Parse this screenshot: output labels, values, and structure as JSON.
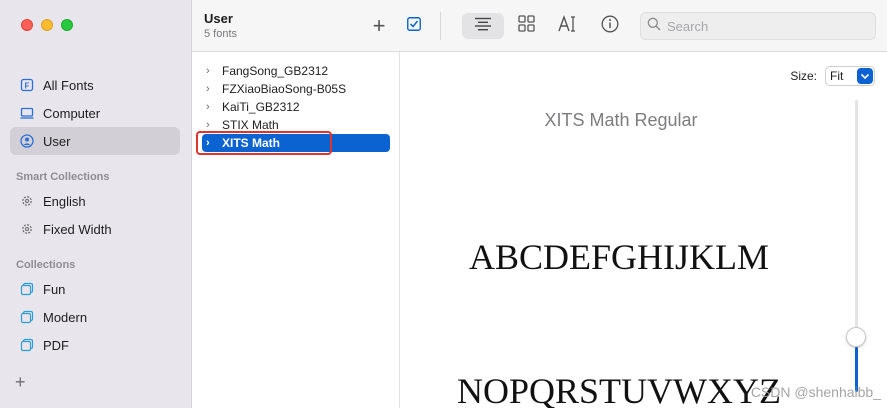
{
  "sidebar": {
    "items_top": [
      {
        "label": "All Fonts",
        "icon": "font-book-icon"
      },
      {
        "label": "Computer",
        "icon": "computer-icon"
      },
      {
        "label": "User",
        "icon": "user-icon",
        "selected": true
      }
    ],
    "smart_collections_heading": "Smart Collections",
    "smart_collections": [
      {
        "label": "English",
        "icon": "gear-icon"
      },
      {
        "label": "Fixed Width",
        "icon": "gear-icon"
      }
    ],
    "collections_heading": "Collections",
    "collections": [
      {
        "label": "Fun",
        "icon": "collection-icon"
      },
      {
        "label": "Modern",
        "icon": "collection-icon"
      },
      {
        "label": "PDF",
        "icon": "collection-icon"
      }
    ],
    "add_label": "+"
  },
  "header": {
    "title": "User",
    "subtitle": "5 fonts",
    "add_label": "+",
    "search_placeholder": "Search"
  },
  "font_list": [
    {
      "name": "FangSong_GB2312"
    },
    {
      "name": "FZXiaoBiaoSong-B05S"
    },
    {
      "name": "KaiTi_GB2312"
    },
    {
      "name": "STIX Math"
    },
    {
      "name": "XITS Math",
      "selected": true
    }
  ],
  "preview": {
    "size_label": "Size:",
    "size_value": "Fit",
    "font_name": "XITS Math Regular",
    "sample_line_1": "ABCDEFGHIJKLM",
    "sample_line_2": "NOPQRSTUVWXYZ",
    "watermark": "CSDN @shenhaibb_"
  },
  "colors": {
    "accent": "#0a63d1",
    "annotation": "#e0342f"
  }
}
